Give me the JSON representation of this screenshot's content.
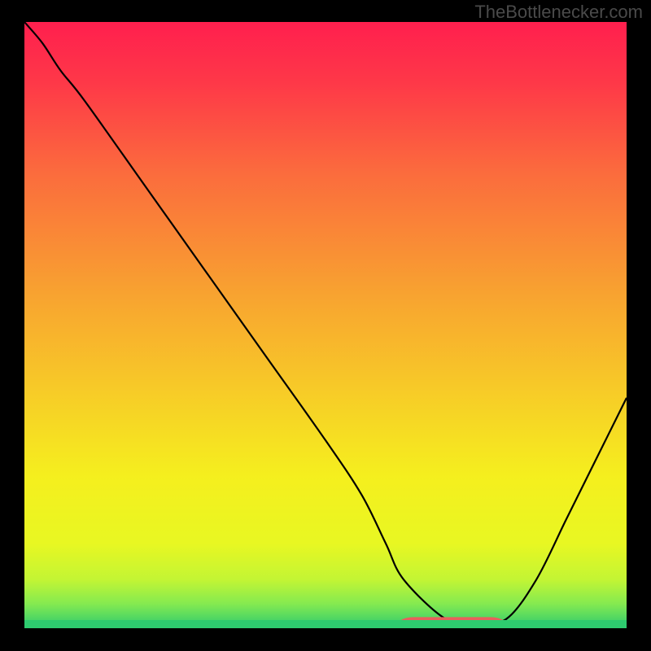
{
  "watermark": "TheBottlenecker.com",
  "colors": {
    "highlight": "#e95f5c",
    "curve": "#000000"
  },
  "chart_data": {
    "type": "line",
    "title": "",
    "xlabel": "",
    "ylabel": "",
    "xlim": [
      0,
      100
    ],
    "ylim": [
      0,
      100
    ],
    "grid": false,
    "gradient_stops": [
      {
        "offset": 0.0,
        "color": "#ff1f4e"
      },
      {
        "offset": 0.1,
        "color": "#fe3848"
      },
      {
        "offset": 0.25,
        "color": "#fb6c3d"
      },
      {
        "offset": 0.45,
        "color": "#f8a330"
      },
      {
        "offset": 0.6,
        "color": "#f7c928"
      },
      {
        "offset": 0.75,
        "color": "#f5ef1e"
      },
      {
        "offset": 0.86,
        "color": "#e8f722"
      },
      {
        "offset": 0.92,
        "color": "#c3f534"
      },
      {
        "offset": 0.96,
        "color": "#84ea50"
      },
      {
        "offset": 1.0,
        "color": "#2dca6f"
      }
    ],
    "series": [
      {
        "name": "curve",
        "x": [
          0.0,
          3.0,
          6.0,
          10.0,
          20.0,
          30.0,
          40.0,
          50.0,
          56.0,
          60.0,
          63.0,
          70.0,
          75.0,
          80.0,
          85.0,
          90.0,
          95.0,
          100.0
        ],
        "y": [
          100.0,
          96.5,
          92.0,
          87.0,
          73.0,
          59.0,
          45.0,
          31.0,
          22.0,
          14.0,
          8.0,
          1.5,
          1.0,
          1.5,
          8.0,
          18.0,
          28.0,
          38.0
        ]
      }
    ],
    "highlight_range_x": [
      62.0,
      80.0
    ],
    "highlight_y": 1.3
  }
}
